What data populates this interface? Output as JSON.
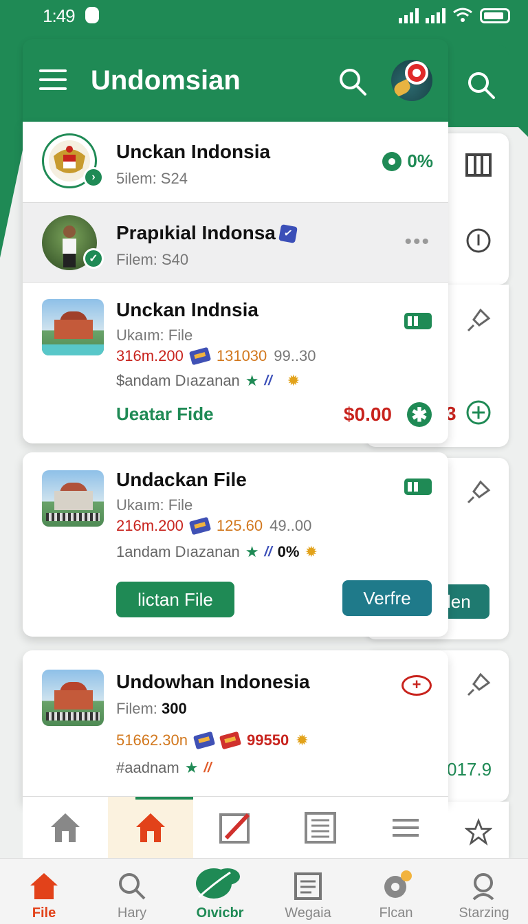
{
  "status": {
    "time": "1:49"
  },
  "header": {
    "title": "Undomsian"
  },
  "rows": [
    {
      "title": "Unckan Indonsia",
      "sub": "5ilem: S24",
      "pct": "0%"
    },
    {
      "title": "Prapıkial Indonsa",
      "sub": "Filem: S40"
    }
  ],
  "cards": [
    {
      "title": "Unckan Indnsia",
      "sub": "Ukaım: File",
      "num1": "316m.200",
      "num2": "131030",
      "num3": "99..30",
      "tags": "$andam Dıazanan",
      "link": "Ueatar Fide",
      "price": "$0.00"
    },
    {
      "title": "Undackan File",
      "sub": "Ukaım: File",
      "num1": "216m.200",
      "num2": "125.60",
      "num3": "49..00",
      "tags": "1andam Dıazanan",
      "tag_extra": "0%",
      "btn_left": "lictan File",
      "btn_right": "Verfre"
    },
    {
      "title": "Undowhan Indonesia",
      "sub_label": "Filem:",
      "sub_value": "300",
      "num1": "51662.30n",
      "num2": "99550",
      "tags": "#aadnam"
    }
  ],
  "back_panel": {
    "partial_price": "3",
    "partial_button": "len",
    "partial_value": "017.9"
  },
  "bottom_nav": [
    {
      "label": "File"
    },
    {
      "label": "Hary"
    },
    {
      "label": "Oıvicbr"
    },
    {
      "label": "Wegaia"
    },
    {
      "label": "Flcan"
    },
    {
      "label": "Starzing"
    }
  ],
  "colors": {
    "brand_green": "#1f8a55",
    "accent_red": "#c8231d",
    "active_orange": "#e2421a",
    "teal": "#1f7a8a"
  }
}
